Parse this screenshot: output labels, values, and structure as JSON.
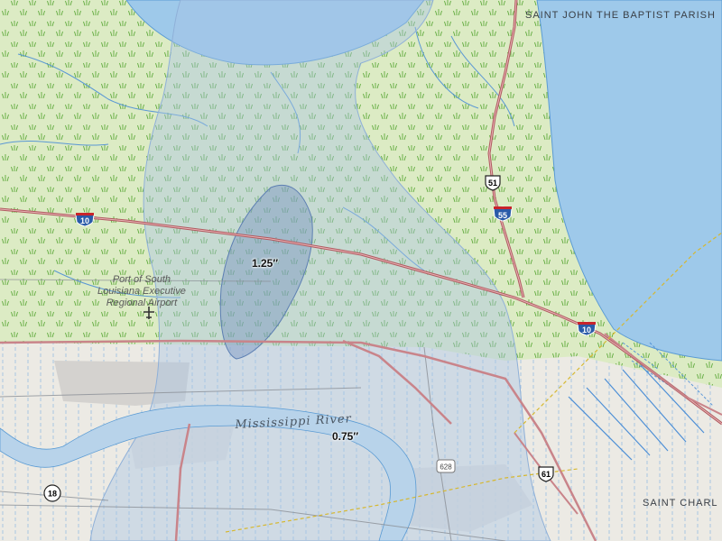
{
  "labels": {
    "parish_north": "SAINT JOHN THE BAPTIST PARISH",
    "parish_south": "SAINT CHARL",
    "airport": [
      "Port of South",
      "Louisiana Executive",
      "Regional Airport"
    ],
    "river": "Mississippi River",
    "precip_high": "1.25″",
    "precip_low": "0.75″"
  },
  "routes": {
    "interstate_10_west": "10",
    "interstate_10_east": "10",
    "interstate_55": "55",
    "us_51": "51",
    "us_61": "61",
    "route_18": "18",
    "route_628": "628"
  },
  "colors": {
    "marsh": "#dcebc4",
    "water": "#9ec9ea",
    "urban": "#d8d8d8",
    "precip_outer": "#a8c4e4",
    "precip_inner": "#6f8fbf",
    "road_major": "#c9848a",
    "interstate_blue": "#2a5ba8",
    "interstate_red": "#c8242b"
  },
  "icons": {
    "airport": "airport-icon",
    "marsh": "marsh-symbol"
  }
}
